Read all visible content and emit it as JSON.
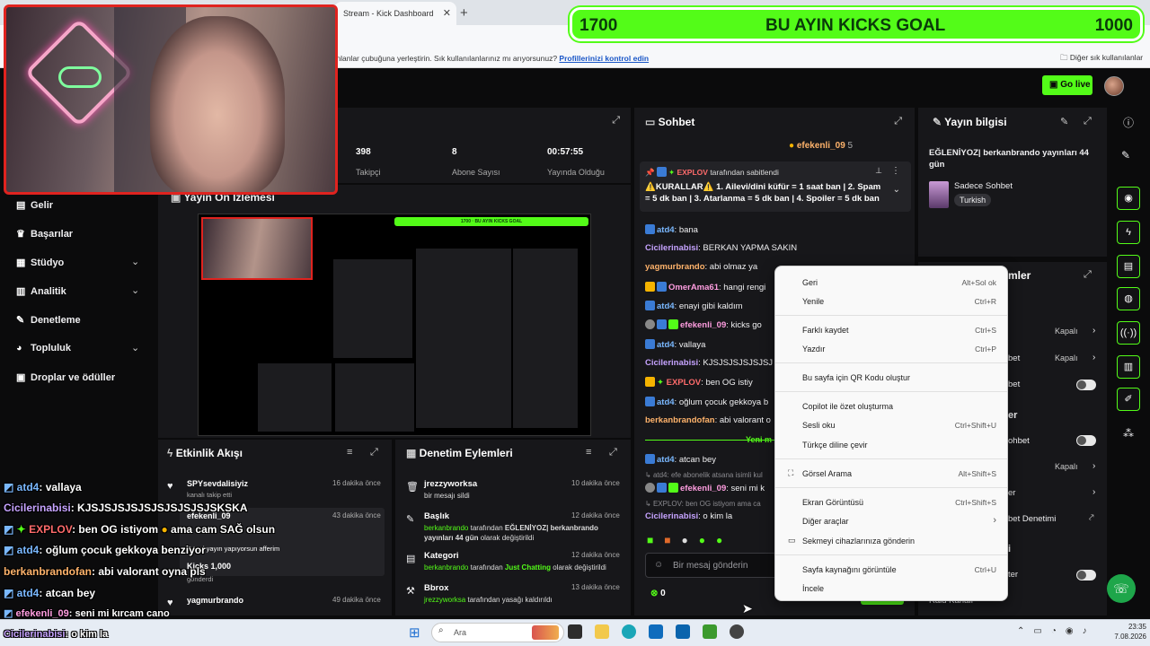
{
  "browser": {
    "tab_title": "Stream - Kick Dashboard",
    "bookmark_message": "ınlanlar çubuğuna yerleştirin. Sık kullanılanlarınız mı arıyorsunuz?",
    "bookmark_link": "Profillerinizi kontrol edin",
    "other_bookmarks": "Diğer sık kullanılanlar"
  },
  "goal": {
    "left": "1700",
    "title": "BU AYIN KICKS GOAL",
    "right": "1000"
  },
  "header": {
    "go_live": "Go live"
  },
  "sidebar": {
    "items": [
      {
        "label": "Gelir",
        "icon": "dollar-icon"
      },
      {
        "label": "Başarılar",
        "icon": "trophy-icon"
      },
      {
        "label": "Stüdyo",
        "icon": "studio-icon"
      },
      {
        "label": "Analitik",
        "icon": "chart-icon"
      },
      {
        "label": "Denetleme",
        "icon": "wrench-icon"
      },
      {
        "label": "Topluluk",
        "icon": "people-icon"
      },
      {
        "label": "Droplar ve ödüller",
        "icon": "gift-icon"
      }
    ]
  },
  "stats": [
    {
      "value": "398",
      "label": "Takipçi"
    },
    {
      "value": "8",
      "label": "Abone Sayısı"
    },
    {
      "value": "00:57:55",
      "label": "Yayında Olduğu"
    }
  ],
  "preview": {
    "title": "Yayın Ön İzlemesi"
  },
  "activity": {
    "title": "Etkinlik Akışı",
    "items": [
      {
        "name": "SPYsevdalisiyiz",
        "sub": "kanalı takip etti",
        "time": "16 dakika önce"
      },
      {
        "name": "efekenli_09",
        "sub": "Güzel yayın yapıyorsun afferim",
        "time": "43 dakika önce"
      },
      {
        "name": "Kicks 1,000",
        "sub": "gönderdi",
        "time": ""
      },
      {
        "name": "yagmurbrando",
        "sub": "",
        "time": "49 dakika önce"
      }
    ]
  },
  "moderation": {
    "title": "Denetim Eylemleri",
    "items": [
      {
        "title": "jrezzyworksa",
        "desc": "bir mesajı sildi",
        "time": "10 dakika önce"
      },
      {
        "title": "Başlık",
        "desc_user": "berkanbrando",
        "desc_mid": "tarafından",
        "desc_value": "EĞLENİYOZ| berkanbrando yayınları 44 gün",
        "desc_end": "olarak değiştirildi",
        "time": "12 dakika önce"
      },
      {
        "title": "Kategori",
        "desc_user": "berkanbrando",
        "desc_mid": "tarafından",
        "desc_value": "Just Chatting",
        "desc_end": "olarak değiştirildi",
        "time": "12 dakika önce"
      },
      {
        "title": "Bbrox",
        "desc_user": "jrezzyworksa",
        "desc_mid": "tarafından yasağı kaldırıldı",
        "time": "13 dakika önce"
      }
    ]
  },
  "chat": {
    "title": "Sohbet",
    "top_user": "efekenli_09",
    "top_count": "5",
    "pinned_by": "EXPLOV",
    "pinned_suffix": "tarafından sabitlendi",
    "pinned_text": "⚠️KURALLAR⚠️ 1. Ailevi/dini küfür = 1 saat ban | 2. Spam = 5 dk ban | 3. Atarlanma = 5 dk ban | 4. Spoiler = 5 dk ban",
    "messages": [
      {
        "user": "atd4",
        "text": "bana"
      },
      {
        "user": "Cicilerinabisi",
        "text": "BERKAN YAPMA SAKIN"
      },
      {
        "user": "yagmurbrando",
        "text": "abi olmaz ya"
      },
      {
        "user": "OmerAma61",
        "text": "hangi rengi"
      },
      {
        "user": "atd4",
        "text": "enayi gibi kaldım"
      },
      {
        "user": "efekenli_09",
        "text": "kicks go"
      },
      {
        "user": "atd4",
        "text": "vallaya"
      },
      {
        "user": "Cicilerinabisi",
        "text": "KJSJSJSJSJSJSJ"
      },
      {
        "user": "EXPLOV",
        "text": "ben OG istiy"
      },
      {
        "user": "atd4",
        "text": "oğlum çocuk gekkoya b"
      },
      {
        "user": "berkanbrandofan",
        "text": "abi valorant o"
      }
    ],
    "new_divider": "Yeni m",
    "after": [
      {
        "user": "atd4",
        "text": "atcan bey"
      },
      {
        "reply": "atd4: efe abonelik atsana isimli kul"
      },
      {
        "user": "efekenli_09",
        "text": "seni mi k"
      },
      {
        "reply": "EXPLOV: ben OG istiyom ama ca"
      },
      {
        "user": "Cicilerinabisi",
        "text": "o kim la"
      }
    ],
    "input_placeholder": "Bir mesaj gönderin",
    "viewer_count": "0"
  },
  "stream_info": {
    "title": "Yayın bilgisi",
    "stream_title": "EĞLENİYOZ| berkanbrando yayınları 44 gün",
    "category": "Sadece Sohbet",
    "language": "Turkish"
  },
  "channel_actions": {
    "title": "mler",
    "rows": [
      {
        "label": "",
        "value": "Kapalı"
      },
      {
        "label": "bet",
        "value": "Kapalı"
      },
      {
        "label": "bet",
        "value": ""
      },
      {
        "label": "er",
        "value": ""
      },
      {
        "label": "ohbet",
        "value": ""
      },
      {
        "label": "",
        "value": "Kapalı"
      },
      {
        "label": "er",
        "value": ""
      },
      {
        "label": "bet Denetimi",
        "value": ""
      },
      {
        "label": "i",
        "value": ""
      },
      {
        "label": "ter",
        "value": ""
      },
      {
        "label": "Raid Kanalı",
        "value": ""
      }
    ]
  },
  "context_menu": {
    "items": [
      {
        "label": "Geri",
        "shortcut": "Alt+Sol ok"
      },
      {
        "label": "Yenile",
        "shortcut": "Ctrl+R"
      },
      {
        "label": "Farklı kaydet",
        "shortcut": "Ctrl+S"
      },
      {
        "label": "Yazdır",
        "shortcut": "Ctrl+P"
      },
      {
        "label": "Bu sayfa için QR Kodu oluştur",
        "shortcut": ""
      },
      {
        "label": "Copilot ile özet oluşturma",
        "shortcut": ""
      },
      {
        "label": "Sesli oku",
        "shortcut": "Ctrl+Shift+U"
      },
      {
        "label": "Türkçe diline çevir",
        "shortcut": ""
      },
      {
        "label": "Görsel Arama",
        "shortcut": "Alt+Shift+S"
      },
      {
        "label": "Ekran Görüntüsü",
        "shortcut": "Ctrl+Shift+S"
      },
      {
        "label": "Diğer araçlar",
        "shortcut": "›"
      },
      {
        "label": "Sekmeyi cihazlarınıza gönderin",
        "shortcut": ""
      },
      {
        "label": "Sayfa kaynağını görüntüle",
        "shortcut": "Ctrl+U"
      },
      {
        "label": "İncele",
        "shortcut": ""
      }
    ]
  },
  "overlay_chat": [
    {
      "user": "atd4",
      "text": ": vallaya"
    },
    {
      "user": "Cicilerinabisi",
      "text": ": KJSJSJSJSJSJSJSJSJSJSKSKA"
    },
    {
      "user": "EXPLOV",
      "text": ": ben OG istiyom",
      "extra": "ama cam SAĞ olsun"
    },
    {
      "user": "atd4",
      "text": ": oğlum çocuk gekkoya benziyor"
    },
    {
      "user": "berkanbrandofan",
      "text": ": abi valorant oyna pls"
    },
    {
      "user": "atd4",
      "text": ": atcan bey"
    },
    {
      "user": "efekenli_09",
      "text": ": seni mi kırcam cano"
    },
    {
      "user": "Cicilerinabisi",
      "text": ": o kim la"
    }
  ],
  "taskbar": {
    "search": "Ara",
    "time": "23:35",
    "date": "7.08.2026"
  }
}
